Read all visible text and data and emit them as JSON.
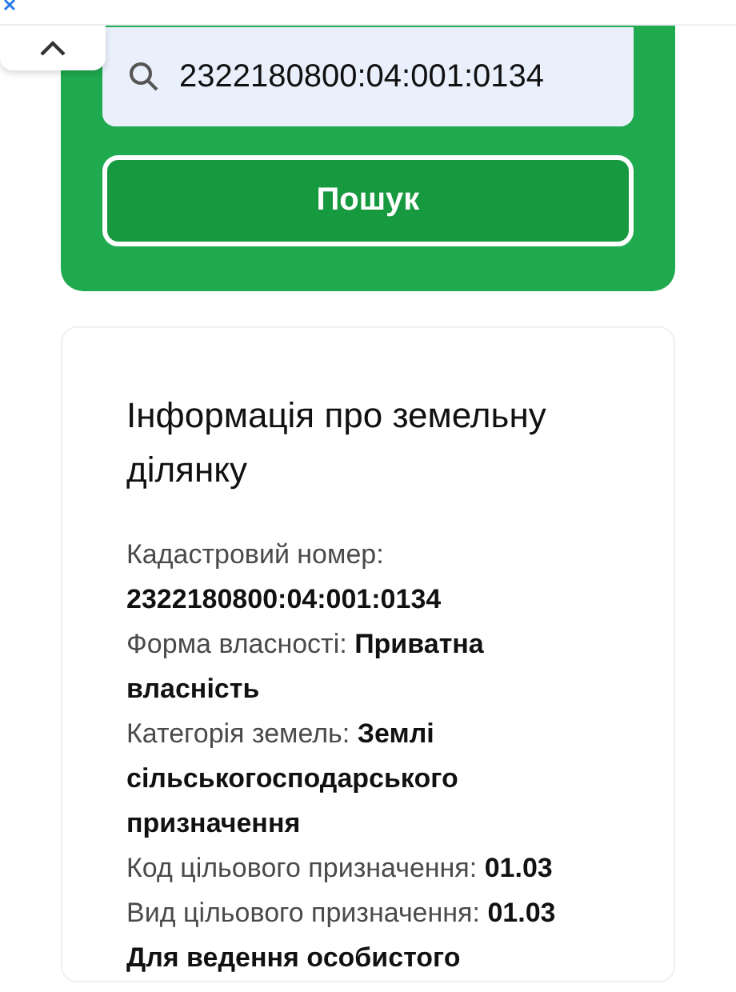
{
  "search": {
    "value": "2322180800:04:001:0134",
    "button": "Пошук"
  },
  "info": {
    "title": "Інформація про земельну ділянку",
    "rows": [
      {
        "label": "Кадастровий номер:",
        "value": "2322180800:04:001:0134"
      },
      {
        "label": "Форма власності:",
        "value": "Приватна власність"
      },
      {
        "label": "Категорія земель:",
        "value": "Землі сільськогосподарського призначення"
      },
      {
        "label": "Код цільового призначення:",
        "value": "01.03"
      },
      {
        "label": "Вид цільового призначення:",
        "value": "01.03 Для ведення особистого"
      }
    ]
  }
}
